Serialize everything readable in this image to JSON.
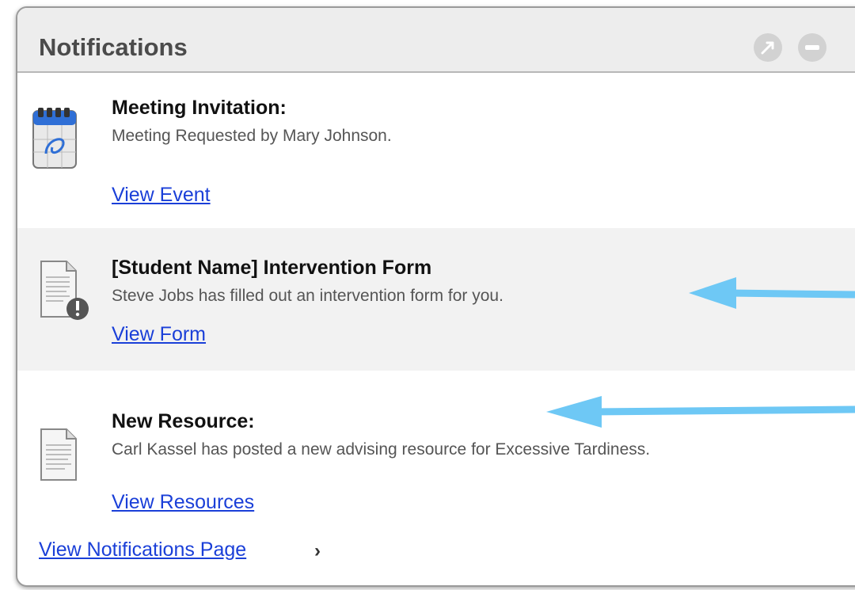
{
  "panel": {
    "title": "Notifications"
  },
  "notifications": [
    {
      "icon": "calendar-icon",
      "title": "Meeting Invitation:",
      "description": "Meeting Requested by Mary Johnson.",
      "link": "View Event"
    },
    {
      "icon": "document-alert-icon",
      "title": "[Student Name] Intervention Form",
      "description": "Steve Jobs has filled out an intervention form for you.",
      "link": "View Form",
      "highlighted": true
    },
    {
      "icon": "document-icon",
      "title": "New Resource:",
      "description": "Carl Kassel has posted a new advising resource for Excessive Tardiness.",
      "link": "View Resources"
    }
  ],
  "footer": {
    "link": "View Notifications Page",
    "chevron": "›"
  },
  "colors": {
    "link": "#1a3fd8",
    "annotation_arrow": "#6ec8f5",
    "highlight_row": "#f2f2f2"
  }
}
